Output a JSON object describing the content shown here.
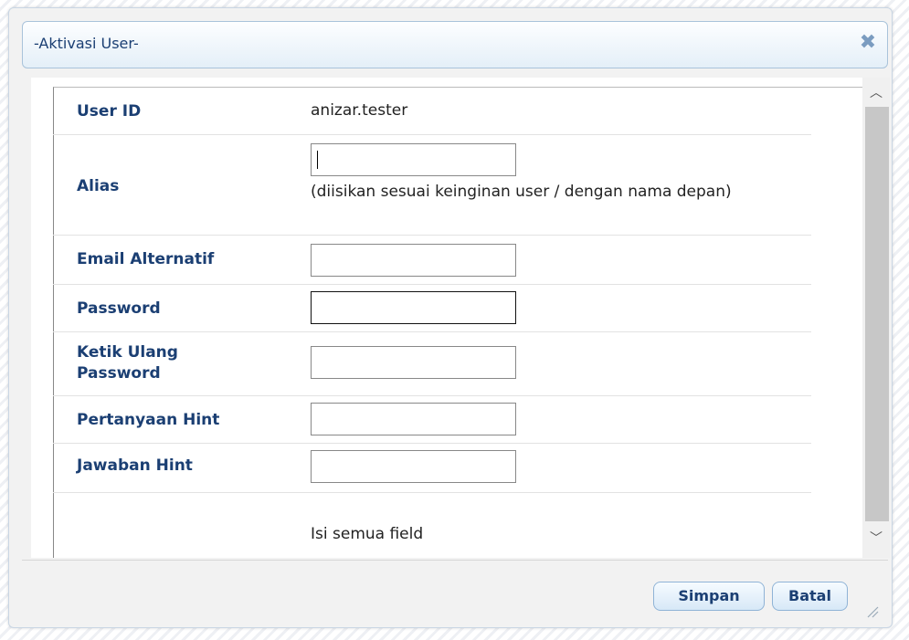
{
  "dialog": {
    "title": "-Aktivasi User-",
    "close_icon": "close-icon"
  },
  "form": {
    "user_id_label": "User ID",
    "user_id_value": "anizar.tester",
    "alias_label": "Alias",
    "alias_value": "",
    "alias_hint": "(diisikan sesuai keinginan user / dengan nama depan)",
    "email_label": "Email Alternatif",
    "email_value": "",
    "password_label": "Password",
    "password_value": "",
    "retype_label_line1": "Ketik Ulang",
    "retype_label_line2": "Password",
    "retype_value": "",
    "hint_question_label": "Pertanyaan Hint",
    "hint_question_value": "",
    "hint_answer_label": "Jawaban Hint",
    "hint_answer_value": "",
    "message": "Isi semua field"
  },
  "footer": {
    "save_label": "Simpan",
    "cancel_label": "Batal"
  },
  "icons": {
    "scroll_up": "chevron-up-icon",
    "scroll_down": "chevron-down-icon",
    "resize": "resize-grip-icon"
  },
  "colors": {
    "label": "#1b3f73",
    "title_bar": "#e4eff8",
    "accent": "#8fb3d6"
  }
}
